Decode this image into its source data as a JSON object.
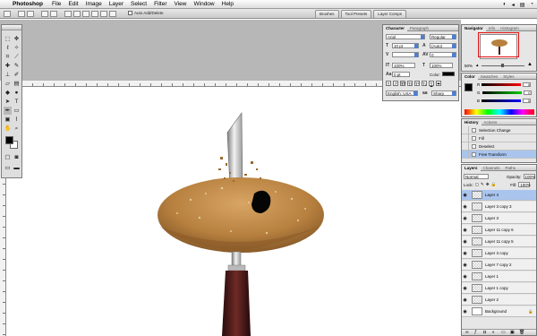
{
  "menubar": {
    "apple_icon": "apple-logo-icon",
    "items": [
      "Photoshop",
      "File",
      "Edit",
      "Image",
      "Layer",
      "Select",
      "Filter",
      "View",
      "Window",
      "Help"
    ]
  },
  "options": {
    "auto_add_delete": "Auto Add/Delete",
    "well_tabs": [
      "Brushes",
      "Tool Presets",
      "Layer Comps"
    ]
  },
  "character": {
    "tabs": [
      "Character",
      "Paragraph"
    ],
    "font_family": "Arial",
    "font_style": "Regular",
    "size": "10 pt",
    "leading": "(Auto)",
    "kerning": "",
    "tracking": "0",
    "vscale": "100%",
    "hscale": "100%",
    "baseline": "0 pt",
    "color_label": "Color:",
    "style_buttons": [
      "T",
      "T",
      "TT",
      "Tr",
      "T¹",
      "T₁",
      "T",
      "T"
    ],
    "language": "English: USA",
    "antialias": "Sharp"
  },
  "navigator": {
    "tabs": [
      "Navigator",
      "Info",
      "Histogram"
    ],
    "zoom": "50%"
  },
  "color": {
    "tabs": [
      "Color",
      "Swatches",
      "Styles"
    ],
    "rows": [
      {
        "label": "R",
        "value": "0",
        "gradient": "linear-gradient(90deg,#000,#f00)"
      },
      {
        "label": "G",
        "value": "0",
        "gradient": "linear-gradient(90deg,#000,#0c0)"
      },
      {
        "label": "B",
        "value": "0",
        "gradient": "linear-gradient(90deg,#000,#00f)"
      }
    ]
  },
  "history": {
    "tabs": [
      "History",
      "Actions"
    ],
    "items": [
      "Selection Change",
      "Fill",
      "Deselect",
      "Free Transform"
    ],
    "active_index": 3
  },
  "layers": {
    "tabs": [
      "Layers",
      "Channels",
      "Paths"
    ],
    "blend_mode": "Normal",
    "opacity_label": "Opacity:",
    "opacity": "100%",
    "lock_label": "Lock:",
    "fill_label": "Fill:",
    "fill": "100%",
    "items": [
      "Layer 4",
      "Layer 3 copy 3",
      "Layer 3",
      "Layer 11 copy 6",
      "Layer 11 copy 5",
      "Layer 3 copy",
      "Layer 7 copy 2",
      "Layer 1",
      "Layer 1 copy",
      "Layer 2",
      "Background"
    ],
    "active_index": 0
  }
}
